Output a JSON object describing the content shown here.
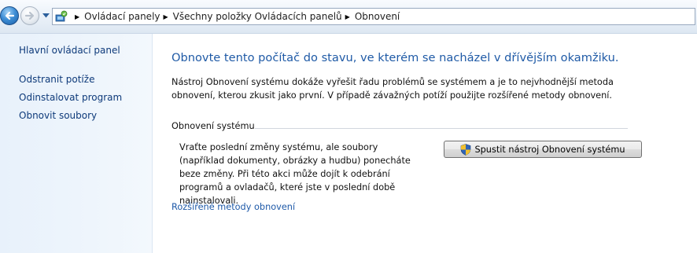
{
  "address_bar": {
    "breadcrumbs": [
      "Ovládací panely",
      "Všechny položky Ovládacích panelů",
      "Obnovení"
    ]
  },
  "left_pane": {
    "home_link": "Hlavní ovládací panel",
    "links": [
      "Odstranit potíže",
      "Odinstalovat program",
      "Obnovit soubory"
    ]
  },
  "main": {
    "heading": "Obnovte tento počítač do stavu, ve kterém se nacházel v dřívějším okamžiku.",
    "description": "Nástroj Obnovení systému dokáže vyřešit řadu problémů se systémem a je to nejvhodnější metoda obnovení, kterou zkusit jako první. V případě závažných potíží použijte rozšířené metody obnovení.",
    "system_restore": {
      "title": "Obnovení systému",
      "text": "Vraťte poslední změny systému, ale soubory (například dokumenty, obrázky a hudbu) ponecháte beze změny. Při této akci může dojít k odebrání programů a ovladačů, které jste v poslední době nainstalovali.",
      "button_label": "Spustit nástroj Obnovení systému"
    },
    "advanced_link": "Rozšířené metody obnovení"
  },
  "icons": {
    "back": "back-arrow-icon",
    "forward": "forward-arrow-icon",
    "history": "history-dropdown-icon",
    "address": "control-panel-icon",
    "button": "uac-shield-icon"
  },
  "colors": {
    "heading": "#1f5aa6",
    "link": "#1e59a8",
    "left_link": "#0e3a7a",
    "left_pane_bg": "#eaf3fc"
  }
}
